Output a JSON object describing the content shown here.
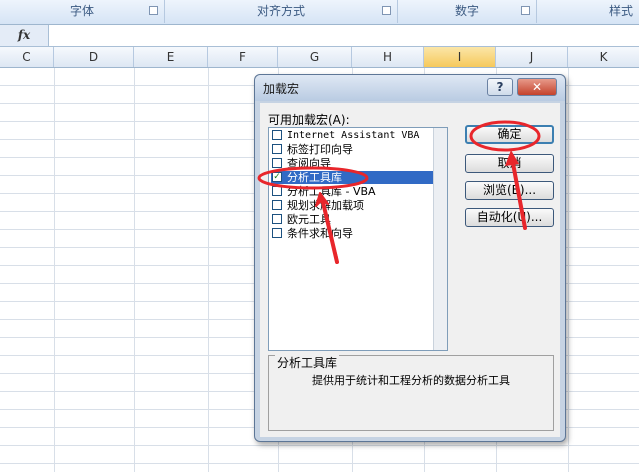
{
  "ribbon": {
    "groups": [
      {
        "label": "字体"
      },
      {
        "label": "对齐方式"
      },
      {
        "label": "数字"
      },
      {
        "label": "样式"
      }
    ]
  },
  "formula_bar": {
    "fx_label": "fx",
    "value": ""
  },
  "columns": [
    "C",
    "D",
    "E",
    "F",
    "G",
    "H",
    "I",
    "J",
    "K"
  ],
  "dialog": {
    "title": "加载宏",
    "help_glyph": "?",
    "close_glyph": "✕",
    "available_label": "可用加载宏(A):",
    "items": [
      {
        "label": "Internet Assistant VBA",
        "checked": false
      },
      {
        "label": "标签打印向导",
        "checked": false
      },
      {
        "label": "查阅向导",
        "checked": false
      },
      {
        "label": "分析工具库",
        "checked": true,
        "selected": true
      },
      {
        "label": "分析工具库 - VBA",
        "checked": false
      },
      {
        "label": "规划求解加载项",
        "checked": false
      },
      {
        "label": "欧元工具",
        "checked": false
      },
      {
        "label": "条件求和向导",
        "checked": false
      }
    ],
    "buttons": {
      "ok": "确定",
      "cancel": "取消",
      "browse": "浏览(B)...",
      "automation": "自动化(U)..."
    },
    "description": {
      "title": "分析工具库",
      "text": "提供用于统计和工程分析的数据分析工具"
    }
  },
  "colors": {
    "annotation_red": "#e8262b",
    "selection_blue": "#316ac5",
    "active_column": "#f6c95c"
  }
}
